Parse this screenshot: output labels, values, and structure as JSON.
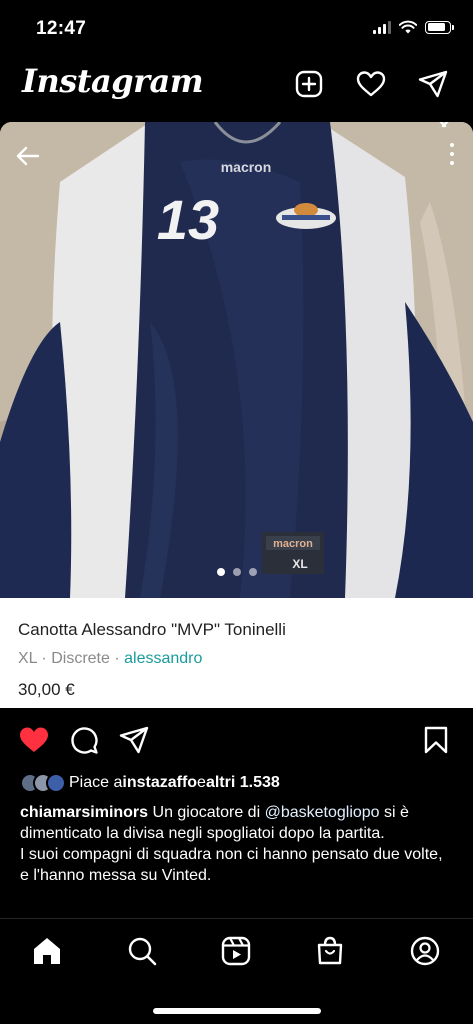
{
  "status_bar": {
    "time": "12:47",
    "icons": [
      "signal-icon",
      "wifi-icon",
      "battery-icon"
    ]
  },
  "header": {
    "logo": "Instagram",
    "icons": [
      "new-post-icon",
      "heart-icon",
      "direct-message-icon"
    ]
  },
  "listing": {
    "title": "Canotta Alessandro \"MVP\" Toninelli",
    "size": "XL",
    "separator": " · ",
    "condition": "Discrete",
    "seller": "alessandro",
    "price": "30,00 €",
    "photo_jersey_number": "13",
    "photo_brand_top": "macron",
    "photo_tag_brand": "macron",
    "photo_tag_size": "XL",
    "carousel": {
      "count": 3,
      "active_index": 0
    }
  },
  "actions": {
    "icons": [
      "liked-heart-icon",
      "comment-icon",
      "share-icon",
      "bookmark-icon"
    ],
    "liked_color": "#ff3040"
  },
  "likes": {
    "prefix": "Piace a ",
    "user": "instazaffo",
    "middle": " e ",
    "others": "altri 1.538"
  },
  "caption": {
    "username": "chiamarsiminors",
    "text_1": " Un giocatore di ",
    "mention": "@basketogliopo",
    "text_2": " si è dimenticato la divisa negli spogliatoi dopo la partita.",
    "text_3": "I suoi compagni di squadra non ci hanno pensato due volte, e l'hanno messa su Vinted."
  },
  "bottom_nav": {
    "items": [
      "home-icon",
      "search-icon",
      "reels-icon",
      "shop-icon",
      "profile-icon"
    ]
  },
  "colors": {
    "background": "#000000",
    "vinted_teal": "#1a9c9c",
    "jersey_navy": "#1f2a4e"
  }
}
